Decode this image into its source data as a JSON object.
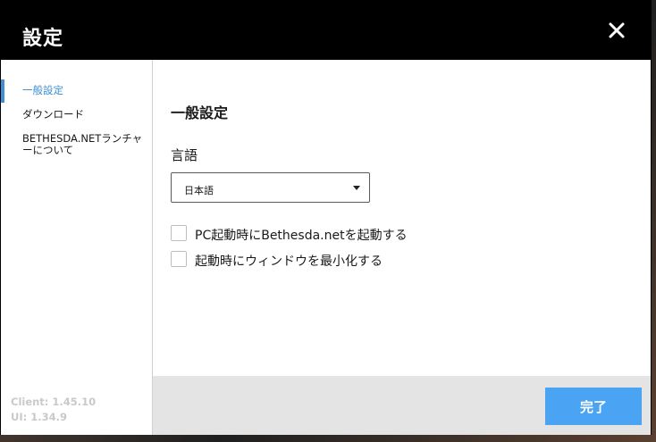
{
  "window": {
    "title": "設定"
  },
  "sidebar": {
    "items": [
      {
        "label": "一般設定"
      },
      {
        "label": "ダウンロード"
      },
      {
        "label": "BETHESDA.NETランチャーについて"
      }
    ],
    "version_client": "Client: 1.45.10",
    "version_ui": "UI: 1.34.9"
  },
  "general": {
    "section_title": "一般設定",
    "language_label": "言語",
    "language_selected": "日本語",
    "options": [
      {
        "label": "PC起動時にBethesda.netを起動する",
        "checked": false
      },
      {
        "label": "起動時にウィンドウを最小化する",
        "checked": false
      }
    ]
  },
  "footer": {
    "done_label": "完了"
  },
  "colors": {
    "accent": "#3d8fd6",
    "button": "#4aa3f3",
    "titlebar": "#000000",
    "footer": "#e4e4e4"
  },
  "icons": {
    "close": "close-icon",
    "dropdown": "chevron-down-icon"
  }
}
